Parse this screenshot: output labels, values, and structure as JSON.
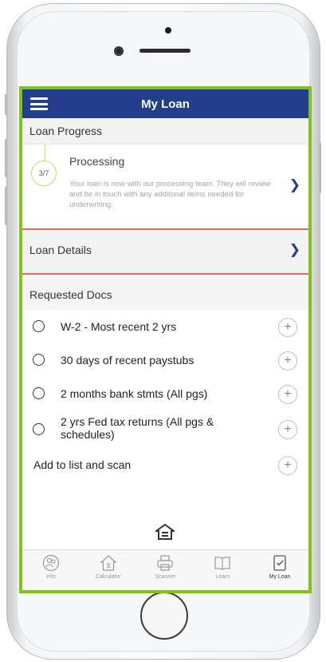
{
  "app": {
    "title": "My Loan"
  },
  "loan_progress": {
    "header": "Loan Progress",
    "step": "3/7",
    "status": "Processing",
    "description": "Your loan is now with our processing team. They will review and be in touch with any additonal items needed for underwriting."
  },
  "loan_details": {
    "label": "Loan Details"
  },
  "requested_docs": {
    "header": "Requested Docs",
    "items": [
      {
        "label": "W-2 - Most recent 2 yrs"
      },
      {
        "label": "30 days of recent paystubs"
      },
      {
        "label": "2 months bank stmts (All pgs)"
      },
      {
        "label": "2 yrs Fed tax returns (All pgs & schedules)"
      }
    ],
    "add_label": "Add to list and scan"
  },
  "tabs": [
    {
      "label": "Info",
      "icon": "info-people-icon"
    },
    {
      "label": "Calculator",
      "icon": "calculator-house-icon"
    },
    {
      "label": "Scanner",
      "icon": "scanner-icon"
    },
    {
      "label": "Learn",
      "icon": "book-icon"
    },
    {
      "label": "My Loan",
      "icon": "checklist-icon"
    }
  ],
  "colors": {
    "appbar": "#233e8b",
    "accent_border": "#7dc51c",
    "divider": "#e66a4c"
  }
}
